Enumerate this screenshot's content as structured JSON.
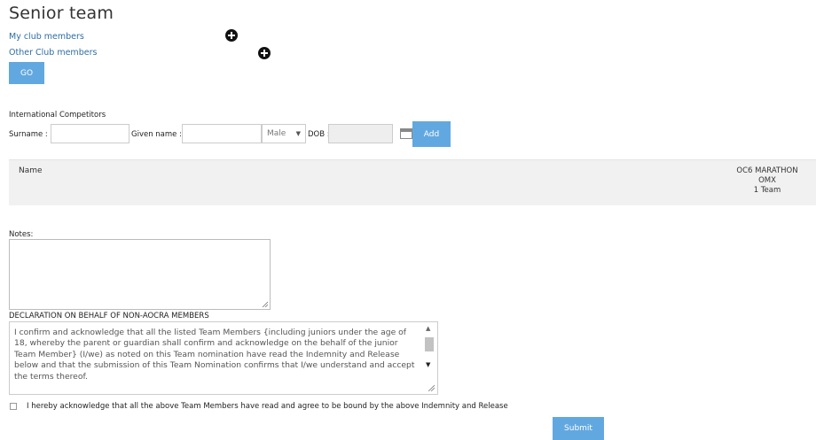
{
  "page": {
    "title": "Senior team"
  },
  "members": {
    "my_club_label": "My club members",
    "other_club_label": "Other Club members",
    "go_label": "GO"
  },
  "international": {
    "heading": "International Competitors",
    "surname_label": "Surname :",
    "surname_value": "",
    "given_name_label": "Given name :",
    "given_name_value": "",
    "gender_selected": "Male",
    "dob_label": "DOB :",
    "dob_value": "",
    "add_label": "Add"
  },
  "table": {
    "name_header": "Name",
    "event_header": {
      "line1": "OC6 MARATHON",
      "line2": "OMX",
      "line3": "1 Team"
    }
  },
  "notes": {
    "label": "Notes:",
    "value": ""
  },
  "declaration": {
    "heading": "DECLARATION ON BEHALF OF NON-AOCRA MEMBERS",
    "text": "I confirm and acknowledge that all the listed Team Members {including juniors under the age of 18, whereby the parent or guardian shall confirm and acknowledge on the behalf of the junior Team Member} (I/we) as noted on this Team nomination have read the Indemnity and Release below and that the submission of this Team Nomination confirms that I/we understand and accept the terms thereof.",
    "acknowledge_label": "I hereby acknowledge that all the above Team Members have read and agree to be bound by the above Indemnity and Release",
    "acknowledge_checked": false
  },
  "submit": {
    "label": "Submit"
  },
  "colors": {
    "accent": "#62a8e0",
    "link": "#2e6da4"
  }
}
